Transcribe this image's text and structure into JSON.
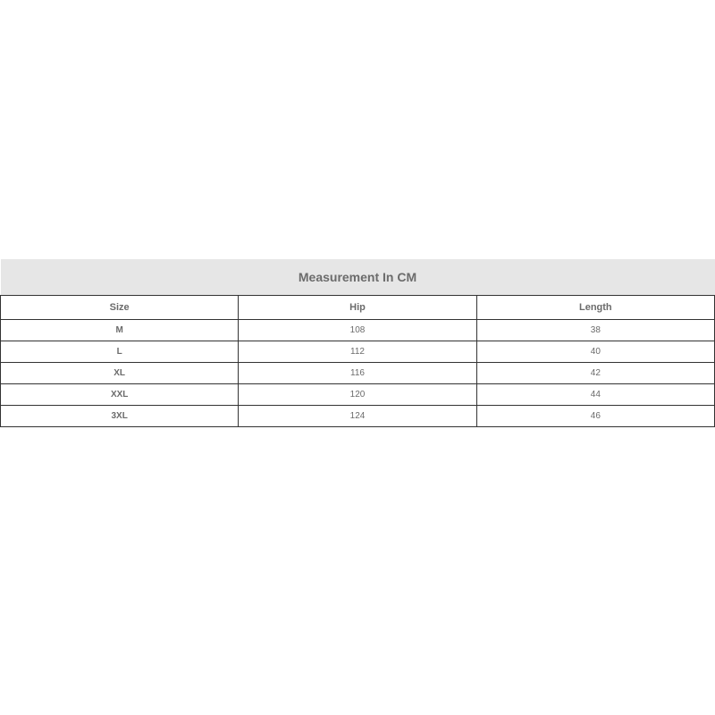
{
  "table": {
    "title": "Measurement In CM",
    "columns": [
      "Size",
      "Hip",
      "Length"
    ],
    "rows": [
      {
        "size": "M",
        "hip": "108",
        "length": "38"
      },
      {
        "size": "L",
        "hip": "112",
        "length": "40"
      },
      {
        "size": "XL",
        "hip": "116",
        "length": "42"
      },
      {
        "size": "XXL",
        "hip": "120",
        "length": "44"
      },
      {
        "size": "3XL",
        "hip": "124",
        "length": "46"
      }
    ]
  }
}
